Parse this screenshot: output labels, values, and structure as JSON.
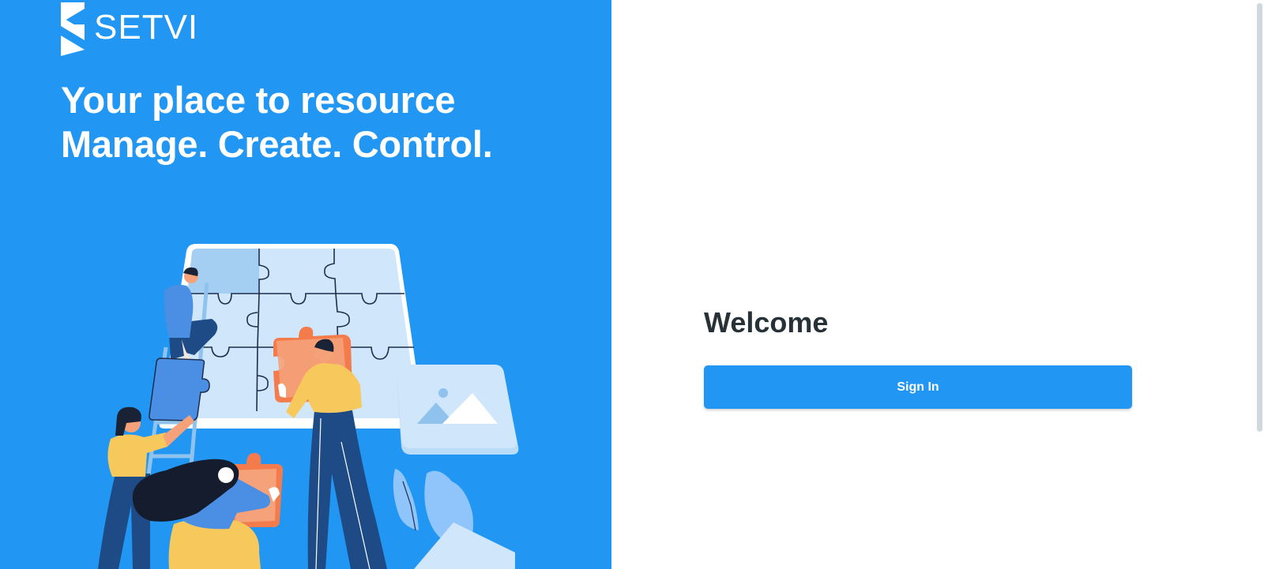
{
  "brand": {
    "name": "SETVI",
    "logo_icon": "setvi-s-mark-icon"
  },
  "hero": {
    "line1": "Your place to resource",
    "line2": "Manage. Create. Control.",
    "illustration": "team-building-puzzle-illustration"
  },
  "login": {
    "heading": "Welcome",
    "signin_label": "Sign In"
  },
  "colors": {
    "brand_blue": "#2196f3",
    "heading_text": "#263238",
    "background": "#ffffff"
  }
}
